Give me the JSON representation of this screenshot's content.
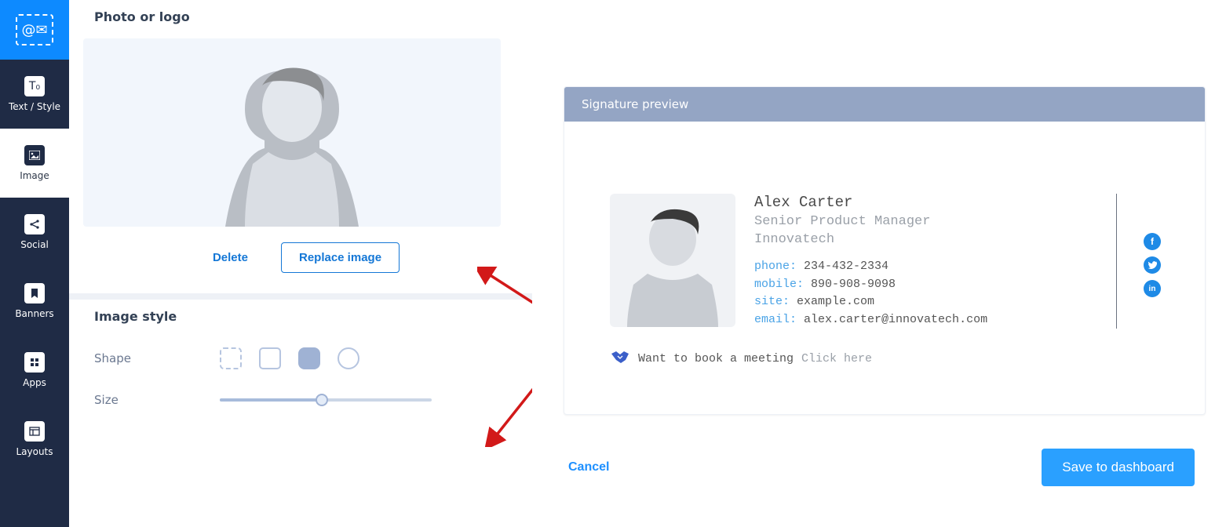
{
  "sidebar": {
    "items": [
      {
        "label": "Text / Style"
      },
      {
        "label": "Image"
      },
      {
        "label": "Social"
      },
      {
        "label": "Banners"
      },
      {
        "label": "Apps"
      },
      {
        "label": "Layouts"
      }
    ]
  },
  "editor": {
    "photo_section_title": "Photo or logo",
    "delete_label": "Delete",
    "replace_label": "Replace image",
    "style_section_title": "Image style",
    "shape_label": "Shape",
    "size_label": "Size"
  },
  "preview": {
    "header": "Signature preview",
    "name": "Alex Carter",
    "title": "Senior Product Manager",
    "company": "Innovatech",
    "phone_label": "phone:",
    "phone": "234-432-2334",
    "mobile_label": "mobile:",
    "mobile": "890-908-9098",
    "site_label": "site:",
    "site": "example.com",
    "email_label": "email:",
    "email": "alex.carter@innovatech.com",
    "meeting_text": "Want to book a meeting",
    "meeting_link": "Click here",
    "social": {
      "facebook": "f",
      "twitter": "t",
      "linkedin": "in"
    }
  },
  "footer": {
    "cancel": "Cancel",
    "save": "Save to dashboard"
  }
}
